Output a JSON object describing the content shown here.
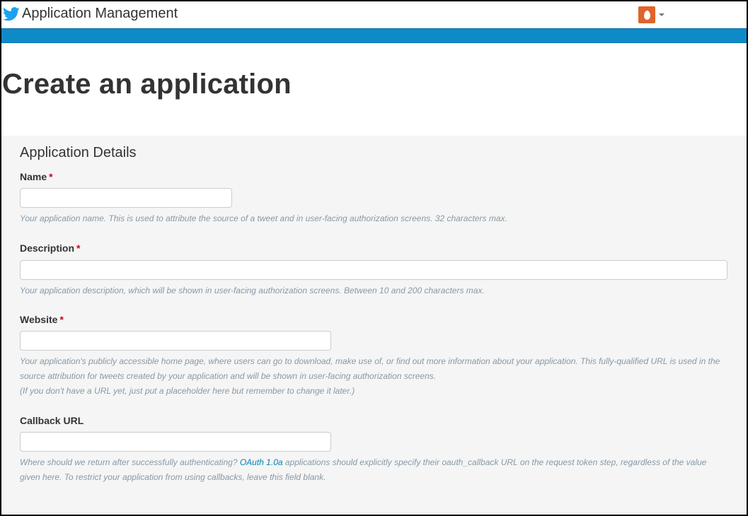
{
  "header": {
    "title": "Application Management"
  },
  "page": {
    "title": "Create an application"
  },
  "form": {
    "section_title": "Application Details",
    "required_mark": "*",
    "name": {
      "label": "Name",
      "value": "",
      "help": "Your application name. This is used to attribute the source of a tweet and in user-facing authorization screens. 32 characters max."
    },
    "description": {
      "label": "Description",
      "value": "",
      "help": "Your application description, which will be shown in user-facing authorization screens. Between 10 and 200 characters max."
    },
    "website": {
      "label": "Website",
      "value": "",
      "help_line1": "Your application's publicly accessible home page, where users can go to download, make use of, or find out more information about your application. This fully-qualified URL is used in the source attribution for tweets created by your application and will be shown in user-facing authorization screens.",
      "help_line2": "(If you don't have a URL yet, just put a placeholder here but remember to change it later.)"
    },
    "callback": {
      "label": "Callback URL",
      "value": "",
      "help_before": "Where should we return after successfully authenticating? ",
      "help_link": "OAuth 1.0a",
      "help_after": " applications should explicitly specify their oauth_callback URL on the request token step, regardless of the value given here. To restrict your application from using callbacks, leave this field blank."
    }
  },
  "icons": {
    "brand": "twitter-bird-icon",
    "avatar": "egg-avatar-icon",
    "menu": "caret-down-icon"
  },
  "colors": {
    "brand_blue": "#1da1f2",
    "bar_blue": "#0f8ac9",
    "avatar_orange": "#e0632b",
    "required_red": "#d0021b",
    "link_blue": "#0084b4"
  }
}
